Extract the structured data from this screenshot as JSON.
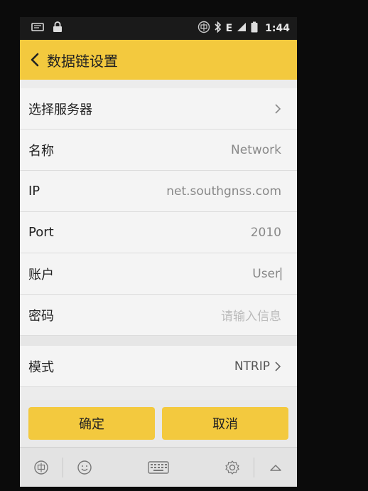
{
  "status_bar": {
    "network": "E",
    "time": "1:44",
    "icons": [
      "chat-icon",
      "lock-icon",
      "input-method-icon",
      "bluetooth-icon",
      "signal-icon",
      "battery-icon"
    ]
  },
  "header": {
    "title": "数据链设置",
    "background": "#f3c93e"
  },
  "settings": {
    "server": {
      "label": "选择服务器"
    },
    "name": {
      "label": "名称",
      "value": "Network"
    },
    "ip": {
      "label": "IP",
      "value": "net.southgnss.com"
    },
    "port": {
      "label": "Port",
      "value": "2010"
    },
    "account": {
      "label": "账户",
      "value": "User"
    },
    "password": {
      "label": "密码",
      "placeholder": "请输入信息"
    },
    "mode": {
      "label": "模式",
      "value": "NTRIP"
    }
  },
  "actions": {
    "confirm_label": "确定",
    "cancel_label": "取消"
  },
  "keyboard_toolbar": {
    "icons": [
      "input-method-icon",
      "emoji-icon",
      "keyboard-icon",
      "gear-icon",
      "collapse-icon"
    ]
  }
}
